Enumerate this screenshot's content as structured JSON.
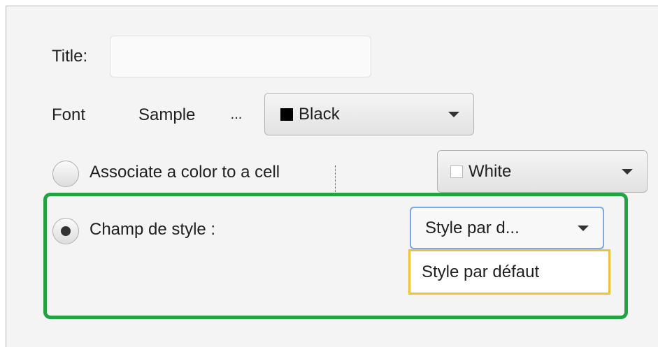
{
  "form": {
    "title_label": "Title:",
    "title_value": "",
    "font_label": "Font",
    "font_sample": "Sample",
    "font_more": "...",
    "font_color": {
      "label": "Black",
      "swatch": "#000000"
    },
    "cell_color_option": {
      "label": "Associate a color to a cell",
      "selected": false
    },
    "cell_color": {
      "label": "White",
      "swatch": "#ffffff"
    },
    "style_option": {
      "label": "Champ de style :",
      "selected": true
    },
    "style_combo": {
      "value": "Style par d..."
    },
    "style_dropdown": {
      "items": [
        "Style par défaut"
      ]
    }
  },
  "colors": {
    "highlight": "#22a341",
    "dropdown_focus": "#7aa8e8",
    "popup_border": "#f0c23b"
  }
}
